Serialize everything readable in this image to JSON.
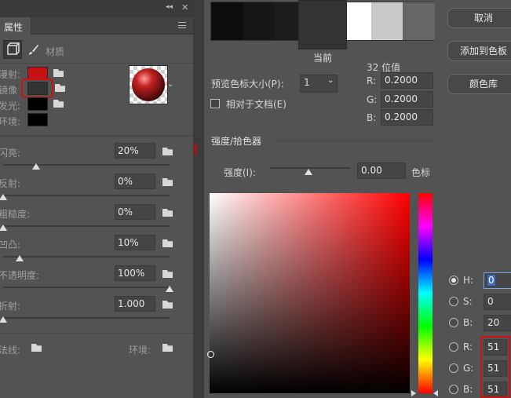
{
  "properties": {
    "tab": "属性",
    "menu_label": "材质",
    "colors": {
      "diffuse": {
        "label": "漫射:",
        "color": "#c41111"
      },
      "specular": {
        "label": "镜像",
        "color": "#333333"
      },
      "glow": {
        "label": "发光:",
        "color": "#000000"
      },
      "ambient": {
        "label": "环境:",
        "color": "#000000"
      }
    },
    "sliders": [
      {
        "label": "闪亮:",
        "value": "20%",
        "level": 0.2
      },
      {
        "label": "反射:",
        "value": "0%",
        "level": 0.0
      },
      {
        "label": "粗糙度:",
        "value": "0%",
        "level": 0.0
      },
      {
        "label": "凹凸:",
        "value": "10%",
        "level": 0.1
      },
      {
        "label": "不透明度:",
        "value": "100%",
        "level": 1.0
      },
      {
        "label": "折射:",
        "value": "1.000",
        "level": 0.0
      }
    ],
    "normal_label": "法线:",
    "environment_label": "环境:"
  },
  "picker": {
    "current_label": "当前",
    "cancel": "取消",
    "add_to_swatches": "添加到色板",
    "color_libraries": "颜色库",
    "bit_depth": "32 位值",
    "preview_size_label": "预览色标大小(P):",
    "preview_size_value": "1",
    "relative_doc_label": "相对于文档(E)",
    "float": {
      "r_label": "R:",
      "r": "0.2000",
      "g_label": "G:",
      "g": "0.2000",
      "b_label": "B:",
      "b": "0.2000"
    },
    "intensity_section": "强度/拾色器",
    "intensity_label": "强度(I):",
    "intensity_value": "0.00",
    "intensity_unit": "色标",
    "hsb": {
      "h_label": "H:",
      "h": "0",
      "s_label": "S:",
      "s": "0",
      "b_label": "B:",
      "b": "20"
    },
    "rgb": {
      "r_label": "R:",
      "r": "51",
      "g_label": "G:",
      "g": "51",
      "b_label": "B:",
      "b": "51"
    },
    "preview_swatches": [
      "#0d0d0d",
      "#161616",
      "#1c1c1c",
      "#333333",
      "#ffffff",
      "#c8c8c8",
      "#666666"
    ],
    "selected_swatch": "#333333",
    "hue_color": "#ff0000"
  }
}
